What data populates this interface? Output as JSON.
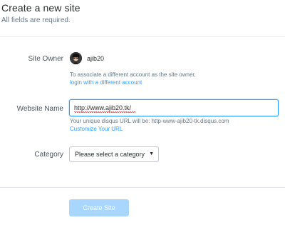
{
  "header": {
    "title": "Create a new site",
    "subtitle": "All fields are required."
  },
  "owner": {
    "label": "Site Owner",
    "username": "ajib20",
    "hint": "To associate a different account as the site owner,",
    "link": "login with a different account"
  },
  "website": {
    "label": "Website Name",
    "value": "http://www.ajib20.tk/",
    "hint": "Your unique disqus URL will be: http-www-ajib20-tk.disqus.com",
    "link": "Customize Your URL"
  },
  "category": {
    "label": "Category",
    "selected": "Please select a category",
    "caret": "▼"
  },
  "actions": {
    "create_label": "Create Site"
  },
  "colors": {
    "accent": "#2e9fff",
    "button_disabled": "#a9d6ff",
    "muted_text": "#687a86"
  },
  "icons": {
    "avatar": "user-avatar-icon",
    "dropdown": "chevron-down-icon"
  }
}
